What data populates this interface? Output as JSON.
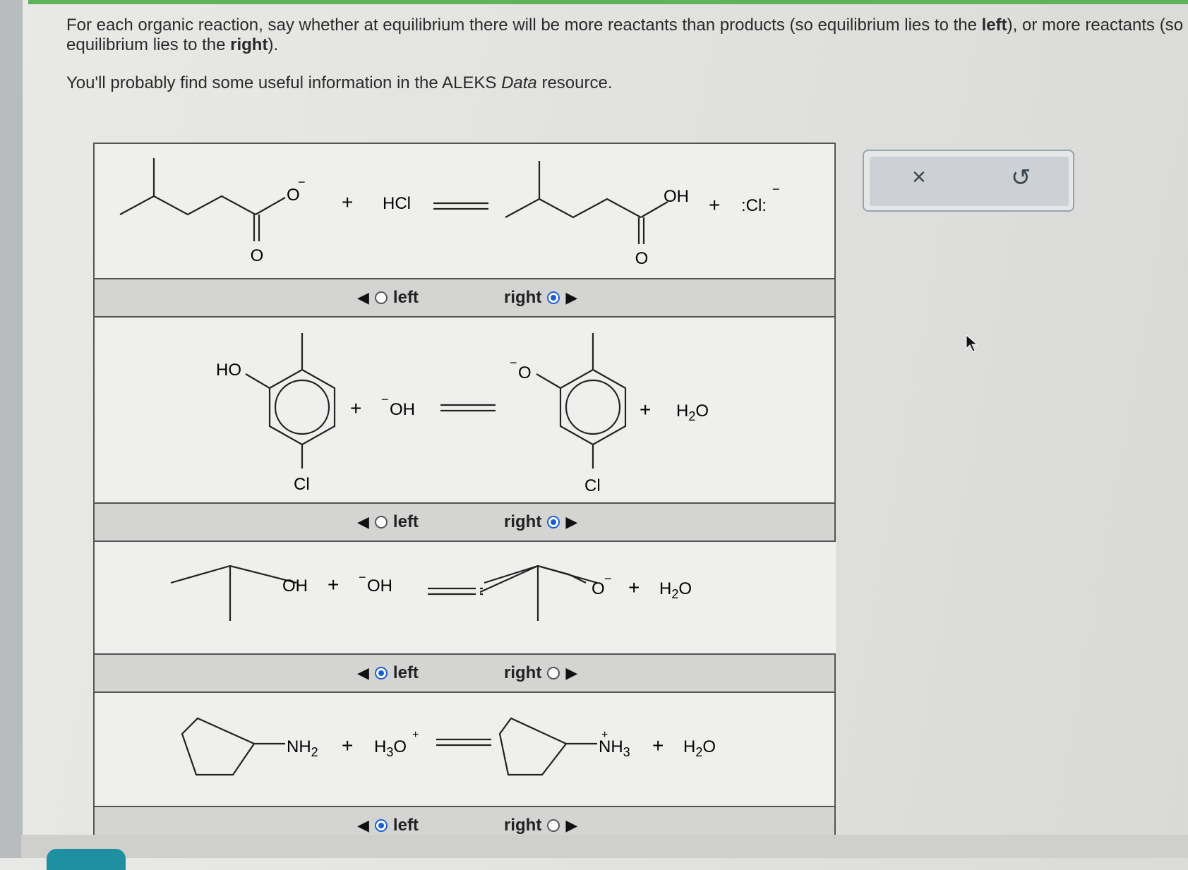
{
  "prompt": {
    "line1_before_left": "For each organic reaction, say whether at equilibrium there will be more reactants than products (so equilibrium lies to the ",
    "left_word": "left",
    "line1_after_left": "), or more reactants (so equilibrium lies to the ",
    "right_word": "right",
    "line1_end": ").",
    "line2_before": "You'll probably find some useful information in the ALEKS ",
    "line2_italic": "Data",
    "line2_after": " resource."
  },
  "reactions": [
    {
      "reactants": [
        "O⁻ (carboxylate)",
        "HCl"
      ],
      "products": [
        "OH (carboxylic acid)",
        ":Cl:⁻"
      ],
      "answer": "right"
    },
    {
      "reactants": [
        "HO (4-chloro-2-methylphenol)",
        "⁻OH"
      ],
      "products": [
        "⁻O (phenoxide)",
        "H2O"
      ],
      "answer": "right"
    },
    {
      "reactants": [
        "OH (alcohol)",
        "⁻OH"
      ],
      "products": [
        "O⁻ (alkoxide)",
        "H2O"
      ],
      "answer": "left"
    },
    {
      "reactants": [
        "NH2 (cyclopentylamine)",
        "H3O⁺"
      ],
      "products": [
        "NH3⁺ (ammonium)",
        "H2O"
      ],
      "answer": "left"
    }
  ],
  "labels": {
    "left": "left",
    "right": "right",
    "plus": "+",
    "HCl": "HCl",
    "OH": "OH",
    "HO": "HO",
    "O": "O",
    "Cl": "Cl",
    "Cl_ion": ":Cl:",
    "H": "H",
    "sub2": "2",
    "sub3": "3",
    "NH": "NH",
    "minus": "−",
    "plus_charge": "+"
  },
  "toolbar": {
    "close_icon": "×",
    "undo_icon": "↺"
  },
  "colors": {
    "selected_radio": "#1a5fd1",
    "top_bar": "#5fb35a",
    "answer_bar": "#d4d5d3"
  }
}
